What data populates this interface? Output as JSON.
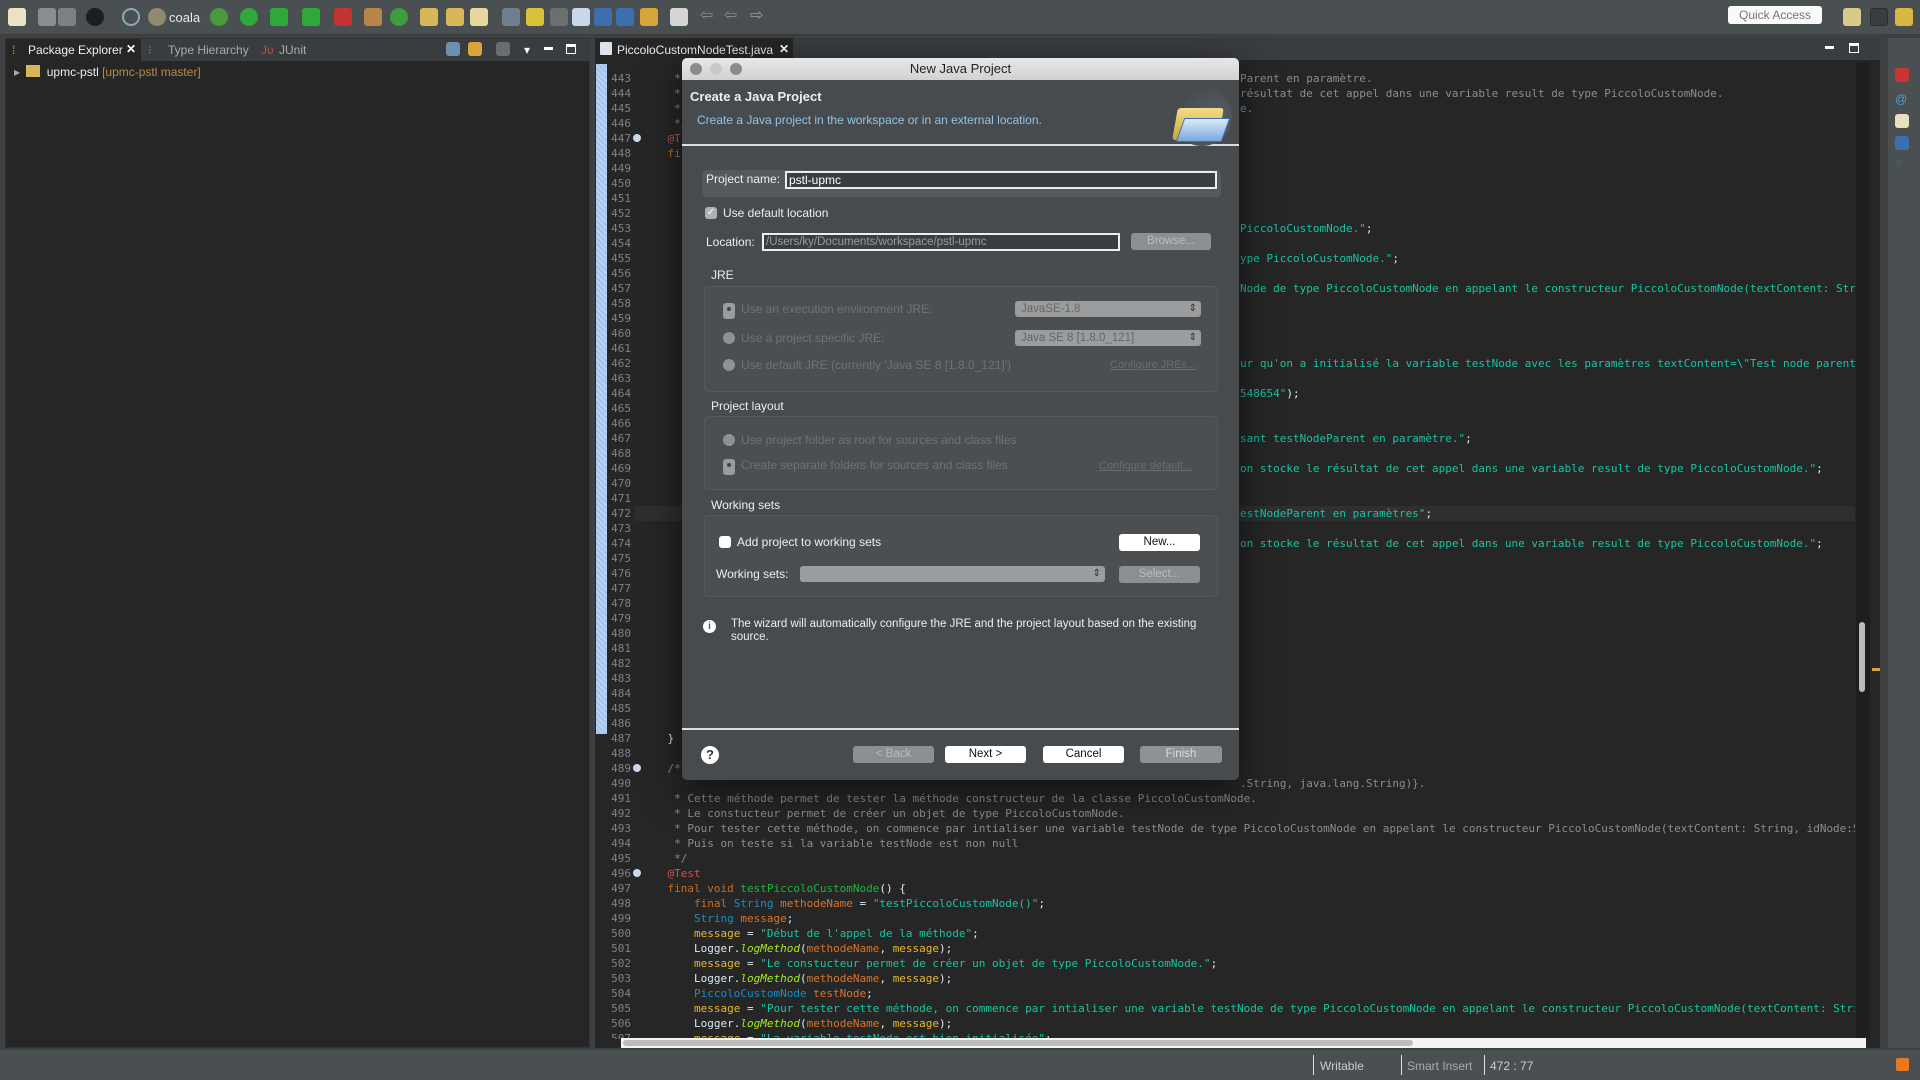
{
  "toolbar": {
    "profile_label": "coala",
    "quick_access_placeholder": "Quick Access"
  },
  "left_panel": {
    "tabs": [
      {
        "label": "Package Explorer",
        "active": true
      },
      {
        "label": "Type Hierarchy"
      },
      {
        "label": "JUnit"
      }
    ],
    "tree": [
      {
        "label": "upmc-pstl",
        "decoration": "[upmc-pstl master]"
      }
    ]
  },
  "editor": {
    "tab_label": "PiccoloCustomNodeTest.java",
    "current_line": 472,
    "line_numbers_start": 443,
    "line_numbers_end": 507,
    "lines": [
      {
        "n": 443,
        "tokens": [
          [
            "     *",
            "comment"
          ]
        ],
        "right": [
          [
            "Parent en paramètre.",
            "comment"
          ]
        ]
      },
      {
        "n": 444,
        "tokens": [
          [
            "     *",
            "comment"
          ]
        ],
        "right": [
          [
            "résultat de cet appel dans une variable result de type PiccoloCustomNode.",
            "comment"
          ]
        ]
      },
      {
        "n": 445,
        "tokens": [
          [
            "     *",
            "comment"
          ]
        ],
        "right": [
          [
            "e.",
            "comment"
          ]
        ]
      },
      {
        "n": 446,
        "tokens": [
          [
            "     */",
            "comment"
          ]
        ]
      },
      {
        "n": 447,
        "tokens": [
          [
            "    @T",
            "annotation"
          ]
        ]
      },
      {
        "n": 448,
        "tokens": [
          [
            "    fi",
            "keyword"
          ]
        ]
      },
      {
        "n": 453,
        "right": [
          [
            "PiccoloCustomNode.\"",
            "string"
          ],
          [
            ";",
            "plain"
          ]
        ]
      },
      {
        "n": 455,
        "right": [
          [
            "ype PiccoloCustomNode.\"",
            "string"
          ],
          [
            ";",
            "plain"
          ]
        ]
      },
      {
        "n": 457,
        "right": [
          [
            "Node de type PiccoloCustomNode en appelant le constructeur PiccoloCustomNode(textContent: Strin",
            "string"
          ]
        ]
      },
      {
        "n": 462,
        "right": [
          [
            "ur qu'on a initialisé la variable testNode avec les paramètres textContent=\\\"Test node parent\\\"",
            "string"
          ]
        ]
      },
      {
        "n": 464,
        "right": [
          [
            "548654\"",
            "string"
          ],
          [
            ");",
            "plain"
          ]
        ]
      },
      {
        "n": 467,
        "right": [
          [
            "sant testNodeParent en paramètre.\"",
            "string"
          ],
          [
            ";",
            "plain"
          ]
        ]
      },
      {
        "n": 469,
        "right": [
          [
            "on stocke le résultat de cet appel dans une variable result de type PiccoloCustomNode.\"",
            "string"
          ],
          [
            ";",
            "plain"
          ]
        ]
      },
      {
        "n": 472,
        "right": [
          [
            "estNodeParent en paramètres\"",
            "string"
          ],
          [
            ";",
            "plain"
          ]
        ]
      },
      {
        "n": 474,
        "right": [
          [
            "on stocke le résultat de cet appel dans une variable result de type PiccoloCustomNode.\"",
            "string"
          ],
          [
            ";",
            "plain"
          ]
        ]
      },
      {
        "n": 487,
        "tokens": [
          [
            "    }",
            "plain"
          ]
        ]
      },
      {
        "n": 489,
        "tokens": [
          [
            "    /**",
            "comment"
          ]
        ]
      },
      {
        "n": 490,
        "right": [
          [
            ".String, java.lang.String)}.",
            "comment"
          ]
        ]
      },
      {
        "n": 491,
        "tokens": [
          [
            "     * Cette méthode permet de tester la méthode constructeur de la classe PiccoloCustomNode.",
            "comment"
          ]
        ]
      },
      {
        "n": 492,
        "tokens": [
          [
            "     * Le constucteur permet de créer un objet de type PiccoloCustomNode.",
            "comment"
          ]
        ]
      },
      {
        "n": 493,
        "tokens": [
          [
            "     * Pour tester cette méthode, on commence par intialiser une variable testNode de type PiccoloCustomNode en appelant le constructeur PiccoloCustomNode(textContent: String, idNode:St",
            "comment"
          ]
        ]
      },
      {
        "n": 494,
        "tokens": [
          [
            "     * Puis on teste si la variable testNode est non null",
            "comment"
          ]
        ]
      },
      {
        "n": 495,
        "tokens": [
          [
            "     */",
            "comment"
          ]
        ]
      },
      {
        "n": 496,
        "tokens": [
          [
            "    @Test",
            "annotation"
          ]
        ]
      },
      {
        "n": 497,
        "tokens": [
          [
            "    final void ",
            "keyword"
          ],
          [
            "testPiccoloCustomNode",
            "decl"
          ],
          [
            "() {",
            "plain"
          ]
        ]
      },
      {
        "n": 498,
        "tokens": [
          [
            "        final ",
            "keyword"
          ],
          [
            "String ",
            "type"
          ],
          [
            "methodeName",
            "local"
          ],
          [
            " = ",
            "plain"
          ],
          [
            "\"testPiccoloCustomNode()\"",
            "string"
          ],
          [
            ";",
            "plain"
          ]
        ]
      },
      {
        "n": 499,
        "tokens": [
          [
            "        String ",
            "type"
          ],
          [
            "message",
            "local"
          ],
          [
            ";",
            "plain"
          ]
        ]
      },
      {
        "n": 500,
        "tokens": [
          [
            "        message",
            "field"
          ],
          [
            " = ",
            "plain"
          ],
          [
            "\"Début de l'appel de la méthode\"",
            "string"
          ],
          [
            ";",
            "plain"
          ]
        ]
      },
      {
        "n": 501,
        "tokens": [
          [
            "        Logger.",
            "plain"
          ],
          [
            "logMethod",
            "method"
          ],
          [
            "(",
            "plain"
          ],
          [
            "methodeName",
            "local"
          ],
          [
            ", ",
            "plain"
          ],
          [
            "message",
            "field"
          ],
          [
            ");",
            "plain"
          ]
        ]
      },
      {
        "n": 502,
        "tokens": [
          [
            "        message",
            "field"
          ],
          [
            " = ",
            "plain"
          ],
          [
            "\"Le constucteur permet de créer un objet de type PiccoloCustomNode.\"",
            "string"
          ],
          [
            ";",
            "plain"
          ]
        ]
      },
      {
        "n": 503,
        "tokens": [
          [
            "        Logger.",
            "plain"
          ],
          [
            "logMethod",
            "method"
          ],
          [
            "(",
            "plain"
          ],
          [
            "methodeName",
            "local"
          ],
          [
            ", ",
            "plain"
          ],
          [
            "message",
            "field"
          ],
          [
            ");",
            "plain"
          ]
        ]
      },
      {
        "n": 504,
        "tokens": [
          [
            "        PiccoloCustomNode ",
            "type"
          ],
          [
            "testNode",
            "local"
          ],
          [
            ";",
            "plain"
          ]
        ]
      },
      {
        "n": 505,
        "tokens": [
          [
            "        message",
            "field"
          ],
          [
            " = ",
            "plain"
          ],
          [
            "\"Pour tester cette méthode, on commence par intialiser une variable testNode de type PiccoloCustomNode en appelant le constructeur PiccoloCustomNode(textContent: Strin",
            "string"
          ]
        ]
      },
      {
        "n": 506,
        "tokens": [
          [
            "        Logger.",
            "plain"
          ],
          [
            "logMethod",
            "method"
          ],
          [
            "(",
            "plain"
          ],
          [
            "methodeName",
            "local"
          ],
          [
            ", ",
            "plain"
          ],
          [
            "message",
            "field"
          ],
          [
            ");",
            "plain"
          ]
        ]
      },
      {
        "n": 507,
        "tokens": [
          [
            "        message",
            "field"
          ],
          [
            " = ",
            "plain"
          ],
          [
            "\"La variable testNode est bien initialisée\"",
            "string"
          ],
          [
            ";",
            "plain"
          ]
        ]
      }
    ]
  },
  "dialog": {
    "title": "New Java Project",
    "header_title": "Create a Java Project",
    "header_subtitle": "Create a Java project in the workspace or in an external location.",
    "project_name_label": "Project name:",
    "project_name_value": "pstl-upmc",
    "use_default_location_label": "Use default location",
    "use_default_location_checked": true,
    "location_label": "Location:",
    "location_value": "/Users/ky/Documents/workspace/pstl-upmc",
    "browse_label": "Browse...",
    "jre": {
      "group_label": "JRE",
      "option_execution_env": "Use an execution environment JRE:",
      "execution_env_value": "JavaSE-1.8",
      "option_project_specific": "Use a project specific JRE:",
      "project_specific_value": "Java SE 8 [1.8.0_121]",
      "option_default": "Use default JRE (currently 'Java SE 8 [1.8.0_121]')",
      "configure_link": "Configure JREs..."
    },
    "layout": {
      "group_label": "Project layout",
      "option_root": "Use project folder as root for sources and class files",
      "option_separate": "Create separate folders for sources and class files",
      "configure_link": "Configure default..."
    },
    "working_sets": {
      "group_label": "Working sets",
      "add_label": "Add project to working sets",
      "add_checked": false,
      "new_label": "New...",
      "sets_label": "Working sets:",
      "select_label": "Select..."
    },
    "info_text": "The wizard will automatically configure the JRE and the project layout based on the existing source.",
    "buttons": {
      "back": "< Back",
      "next": "Next >",
      "cancel": "Cancel",
      "finish": "Finish"
    }
  },
  "status_bar": {
    "writable": "Writable",
    "insert_mode": "Smart Insert",
    "position": "472 : 77"
  }
}
